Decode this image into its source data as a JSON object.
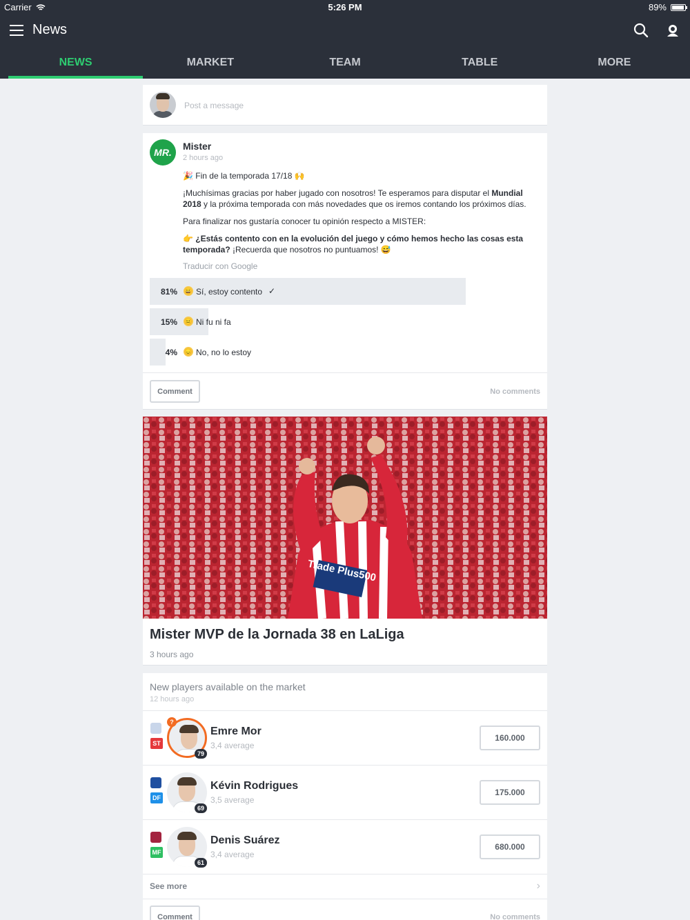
{
  "status_bar": {
    "carrier": "Carrier",
    "time": "5:26 PM",
    "battery": "89%"
  },
  "header": {
    "title": "News"
  },
  "tabs": [
    {
      "label": "NEWS",
      "active": true
    },
    {
      "label": "MARKET"
    },
    {
      "label": "TEAM"
    },
    {
      "label": "TABLE"
    },
    {
      "label": "MORE"
    }
  ],
  "composer": {
    "placeholder": "Post a message"
  },
  "mister_post": {
    "logo_text": "MR.",
    "author": "Mister",
    "time_ago": "2 hours ago",
    "line1": "Fin de la temporada 17/18",
    "para1_a": "¡Muchísimas gracias por haber jugado con nosotros! Te esperamos para disputar el ",
    "para1_bold": "Mundial 2018",
    "para1_b": " y la próxima temporada con más novedades que os iremos contando los próximos días.",
    "para2": "Para finalizar nos gustaría conocer tu opinión respecto a MISTER:",
    "question_bold": "¿Estás contento con en la evolución del juego y cómo hemos hecho las cosas esta temporada?",
    "question_rest": " ¡Recuerda que nosotros no puntuamos!",
    "translate": "Traducir con Google",
    "poll": [
      {
        "percent": "81%",
        "value": 81,
        "label": "Sí, estoy contento",
        "check": "✓"
      },
      {
        "percent": "15%",
        "value": 15,
        "label": "Ni fu ni fa"
      },
      {
        "percent": "4%",
        "value": 4,
        "label": "No, no lo estoy"
      }
    ],
    "comment_label": "Comment",
    "comments_count": "No comments"
  },
  "mvp_post": {
    "jersey_text": "Trade Plus500",
    "title": "Mister MVP de la Jornada 38 en LaLiga",
    "time_ago": "3 hours ago"
  },
  "market_post": {
    "title": "New players available on the market",
    "time_ago": "12 hours ago",
    "players": [
      {
        "name": "Emre Mor",
        "average": "3,4 average",
        "position": "ST",
        "pos_color": "#e5383b",
        "score": "79",
        "price": "160.000",
        "club_color": "#c9d6ea",
        "alert": "?"
      },
      {
        "name": "Kévin Rodrigues",
        "average": "3,5 average",
        "position": "DF",
        "pos_color": "#1e90e8",
        "score": "69",
        "price": "175.000",
        "club_color": "#1f4fa0"
      },
      {
        "name": "Denis Suárez",
        "average": "3,4 average",
        "position": "MF",
        "pos_color": "#2fbf62",
        "score": "61",
        "price": "680.000",
        "club_color": "#a3233f"
      }
    ],
    "see_more": "See more",
    "comment_label": "Comment",
    "comments_count": "No comments"
  }
}
